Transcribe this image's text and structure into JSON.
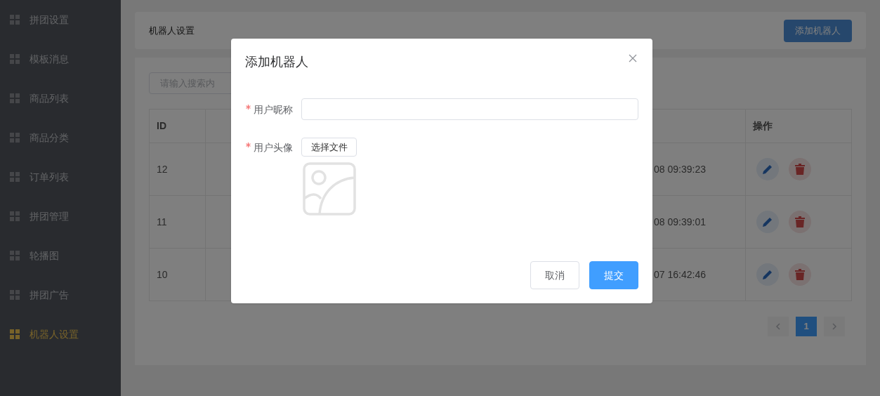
{
  "sidebar": {
    "items": [
      {
        "label": "拼团设置",
        "selected": false
      },
      {
        "label": "模板消息",
        "selected": false
      },
      {
        "label": "商品列表",
        "selected": false
      },
      {
        "label": "商品分类",
        "selected": false
      },
      {
        "label": "订单列表",
        "selected": false
      },
      {
        "label": "拼团管理",
        "selected": false
      },
      {
        "label": "轮播图",
        "selected": false
      },
      {
        "label": "拼团广告",
        "selected": false
      },
      {
        "label": "机器人设置",
        "selected": true
      }
    ]
  },
  "header": {
    "title": "机器人设置",
    "add_button": "添加机器人"
  },
  "search": {
    "placeholder": "请输入搜索内"
  },
  "table": {
    "columns": [
      "ID",
      "操作"
    ],
    "rows": [
      {
        "id": "12",
        "time": "08 09:39:23"
      },
      {
        "id": "11",
        "time": "08 09:39:01"
      },
      {
        "id": "10",
        "time": "07 16:42:46"
      }
    ]
  },
  "pagination": {
    "pages": [
      {
        "label": "1",
        "selected": true
      }
    ]
  },
  "dialog": {
    "title": "添加机器人",
    "fields": [
      {
        "kind": "text",
        "label": "用户昵称",
        "required": true
      },
      {
        "kind": "file",
        "label": "用户头像",
        "required": true,
        "button": "选择文件"
      }
    ],
    "buttons": [
      {
        "label": "取消",
        "kind": "default"
      },
      {
        "label": "提交",
        "kind": "primary"
      }
    ]
  }
}
